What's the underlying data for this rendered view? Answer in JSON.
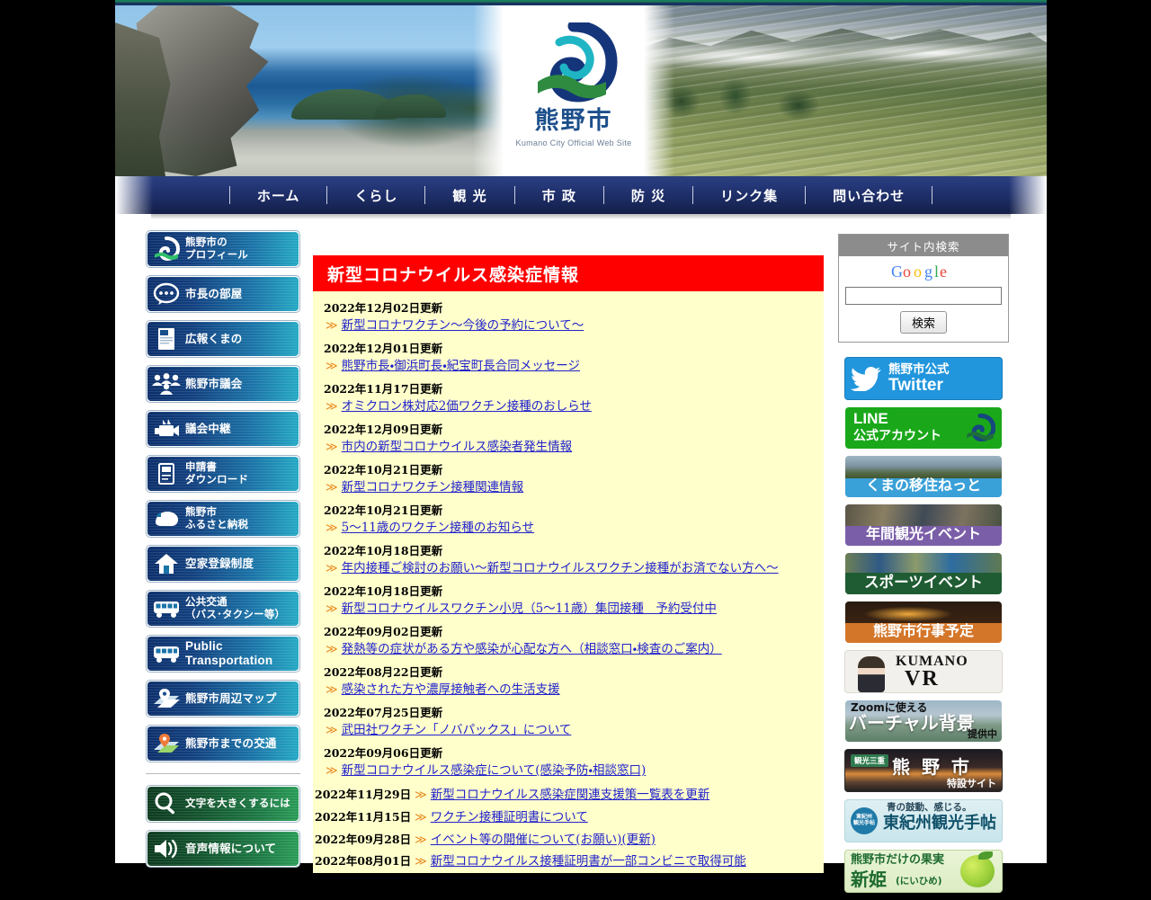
{
  "site": {
    "logo_kanji": "熊野市",
    "logo_subtitle": "Kumano City Official Web Site"
  },
  "nav": {
    "items": [
      {
        "label": "ホーム",
        "name": "nav-home"
      },
      {
        "label": "くらし",
        "name": "nav-living"
      },
      {
        "label": "観 光",
        "name": "nav-tourism"
      },
      {
        "label": "市 政",
        "name": "nav-city-government"
      },
      {
        "label": "防 災",
        "name": "nav-disaster-prevention"
      },
      {
        "label": "リンク集",
        "name": "nav-links"
      },
      {
        "label": "問い合わせ",
        "name": "nav-contact"
      }
    ]
  },
  "sidebar": {
    "items": [
      {
        "label": "熊野市の\nプロフィール",
        "icon": "wave-logo-icon",
        "style": "blue",
        "size": "small"
      },
      {
        "label": "市長の部屋",
        "icon": "speech-bubble-icon",
        "style": "blue",
        "size": "normal"
      },
      {
        "label": "広報くまの",
        "icon": "booklet-icon",
        "style": "blue",
        "size": "normal"
      },
      {
        "label": "熊野市議会",
        "icon": "assembly-people-icon",
        "style": "blue",
        "size": "normal"
      },
      {
        "label": "議会中継",
        "icon": "video-camera-icon",
        "style": "blue",
        "size": "normal"
      },
      {
        "label": "申請書\nダウンロード",
        "icon": "document-download-icon",
        "style": "blue",
        "size": "small"
      },
      {
        "label": "熊野市\nふるさと納税",
        "icon": "hand-coin-icon",
        "style": "blue",
        "size": "small"
      },
      {
        "label": "空家登録制度",
        "icon": "house-icon",
        "style": "blue",
        "size": "normal"
      },
      {
        "label": "公共交通\n（バス･タクシー等）",
        "icon": "bus-icon",
        "style": "blue",
        "size": "small"
      },
      {
        "label": "Public\nTransportation",
        "icon": "bus-icon",
        "style": "blue",
        "size": "latin"
      },
      {
        "label": "熊野市周辺マップ",
        "icon": "map-pin-icon",
        "style": "blue",
        "size": "normal"
      },
      {
        "label": "熊野市までの交通",
        "icon": "map-route-icon",
        "style": "blue",
        "size": "normal"
      }
    ],
    "accessibility_items": [
      {
        "label": "文字を大きくするには",
        "icon": "magnifier-icon",
        "style": "green",
        "size": "small"
      },
      {
        "label": "音声情報について",
        "icon": "speaker-icon",
        "style": "green",
        "size": "normal"
      }
    ]
  },
  "main": {
    "alert_title": "新型コロナウイルス感染症情報",
    "marker": "≫",
    "stacked_news": [
      {
        "date": "2022年12月02日更新",
        "title": "新型コロナワクチン～今後の予約について～"
      },
      {
        "date": "2022年12月01日更新",
        "title": "熊野市長・御浜町長・紀宝町長合同メッセージ"
      },
      {
        "date": "2022年11月17日更新",
        "title": "オミクロン株対応2価ワクチン接種のおしらせ"
      },
      {
        "date": "2022年12月09日更新",
        "title": "市内の新型コロナウイルス感染者発生情報"
      },
      {
        "date": "2022年10月21日更新",
        "title": "新型コロナワクチン接種関連情報"
      },
      {
        "date": "2022年10月21日更新",
        "title": "5～11歳のワクチン接種のお知らせ"
      },
      {
        "date": "2022年10月18日更新",
        "title": "年内接種ご検討のお願い～新型コロナウイルスワクチン接種がお済でない方へ～"
      },
      {
        "date": "2022年10月18日更新",
        "title": "新型コロナウイルスワクチン小児（5～11歳）集団接種　予約受付中"
      },
      {
        "date": "2022年09月02日更新",
        "title": "発熱等の症状がある方や感染が心配な方へ（相談窓口・検査のご案内）"
      },
      {
        "date": "2022年08月22日更新",
        "title": "感染された方や濃厚接触者への生活支援"
      },
      {
        "date": "2022年07月25日更新",
        "title": "武田社ワクチン「ノバパックス」について"
      },
      {
        "date": "2022年09月06日更新",
        "title": "新型コロナウイルス感染症について(感染予防・相談窓口)"
      }
    ],
    "inline_news": [
      {
        "date": "2022年11月29日",
        "title": "新型コロナウイルス感染症関連支援策一覧表を更新"
      },
      {
        "date": "2022年11月15日",
        "title": "ワクチン接種証明書について"
      },
      {
        "date": "2022年09月28日",
        "title": "イベント等の開催について(お願い)(更新)"
      },
      {
        "date": "2022年08月01日",
        "title": "新型コロナウイルス接種証明書が一部コンビニで取得可能"
      }
    ]
  },
  "search": {
    "heading": "サイト内検索",
    "engine": "Google",
    "value": "",
    "placeholder": "",
    "button_label": "検索"
  },
  "banners": [
    {
      "name": "banner-twitter",
      "line1": "熊野市公式",
      "line2": "Twitter",
      "kind": "twitter"
    },
    {
      "name": "banner-line",
      "line1": "LINE",
      "line2": "公式アカウント",
      "kind": "line"
    },
    {
      "name": "banner-iju-net",
      "line1": "くまの移住ねっと",
      "line2": "",
      "kind": "iju"
    },
    {
      "name": "banner-annual-tourism-events",
      "line1": "年間観光イベント",
      "line2": "",
      "kind": "event"
    },
    {
      "name": "banner-sports-events",
      "line1": "スポーツイベント",
      "line2": "",
      "kind": "sports"
    },
    {
      "name": "banner-city-event-schedule",
      "line1": "熊野市行事予定",
      "line2": "",
      "kind": "gyoji"
    },
    {
      "name": "banner-kumano-vr",
      "line1": "KUMANO",
      "line2": "VR",
      "kind": "vr"
    },
    {
      "name": "banner-virtual-background",
      "line1": "Zoomに使える",
      "line2": "バーチャル背景",
      "line3": "提供中",
      "kind": "zoom"
    },
    {
      "name": "banner-kanko-mie-kumano",
      "tag": "観光三重",
      "line1": "熊 野 市",
      "line2": "特設サイト",
      "kind": "mie"
    },
    {
      "name": "banner-higashikishu-guide",
      "badge": "東紀州\n観光手帖",
      "line1": "青の鼓動、感じる。",
      "line2": "東紀州観光手帖",
      "kind": "hk"
    },
    {
      "name": "banner-niihime",
      "line1": "熊野市だけの果実",
      "line2": "新姫",
      "line3": "(にいひめ)",
      "kind": "nh"
    }
  ],
  "colors": {
    "alert_red": "#ff0000",
    "news_bg": "#ffffcc",
    "link_blue": "#2222cc",
    "marker_orange": "#e8891f",
    "nav_navy": "#1d2d66",
    "logo_blue": "#1d4f8c"
  }
}
